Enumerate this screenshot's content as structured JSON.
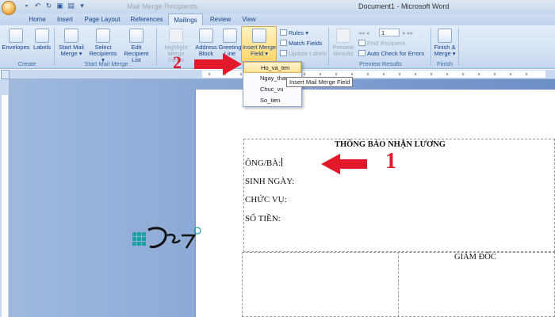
{
  "window": {
    "title": "Document1 - Microsoft Word",
    "ghost_title": "Mail Merge Recipients"
  },
  "tabs": [
    "Home",
    "Insert",
    "Page Layout",
    "References",
    "Mailings",
    "Review",
    "View"
  ],
  "active_tab": "Mailings",
  "ribbon": {
    "create": {
      "label": "Create",
      "envelopes": "Envelopes",
      "labels": "Labels"
    },
    "start_merge": {
      "label": "Start Mail Merge",
      "start_1": "Start Mail",
      "start_2": "Merge ▾",
      "select_1": "Select",
      "select_2": "Recipients ▾",
      "edit_1": "Edit",
      "edit_2": "Recipient List"
    },
    "write_insert": {
      "highlight_1": "Highlight",
      "highlight_2": "Merge Fields",
      "address_1": "Address",
      "address_2": "Block",
      "greeting_1": "Greeting",
      "greeting_2": "Line",
      "insert_1": "Insert Merge",
      "insert_2": "Field ▾",
      "rules": "Rules ▾",
      "match": "Match Fields",
      "update": "Update Labels"
    },
    "preview": {
      "label": "Preview Results",
      "preview_1": "Preview",
      "preview_2": "Results",
      "record": "1",
      "find": "Find Recipient",
      "auto_check": "Auto Check for Errors"
    },
    "finish": {
      "label": "Finish",
      "finish_1": "Finish &",
      "finish_2": "Merge ▾"
    }
  },
  "dropdown": {
    "items": [
      "Ho_va_ten",
      "Ngay_thang",
      "Chuc_vu",
      "So_tien"
    ],
    "hovered_index": 0,
    "tooltip": "Insert Mail Merge Field"
  },
  "document": {
    "heading": "THÔNG BÁO NHẬN LƯƠNG",
    "lines": [
      "ÔNG/BÀ:",
      "SINH NGÀY:",
      "CHỨC VỤ:",
      "SỐ TIỀN:"
    ],
    "signature": "GIÁM ĐỐC"
  },
  "annotations": {
    "step1": "1",
    "step2": "2",
    "color": "#e2192a"
  }
}
